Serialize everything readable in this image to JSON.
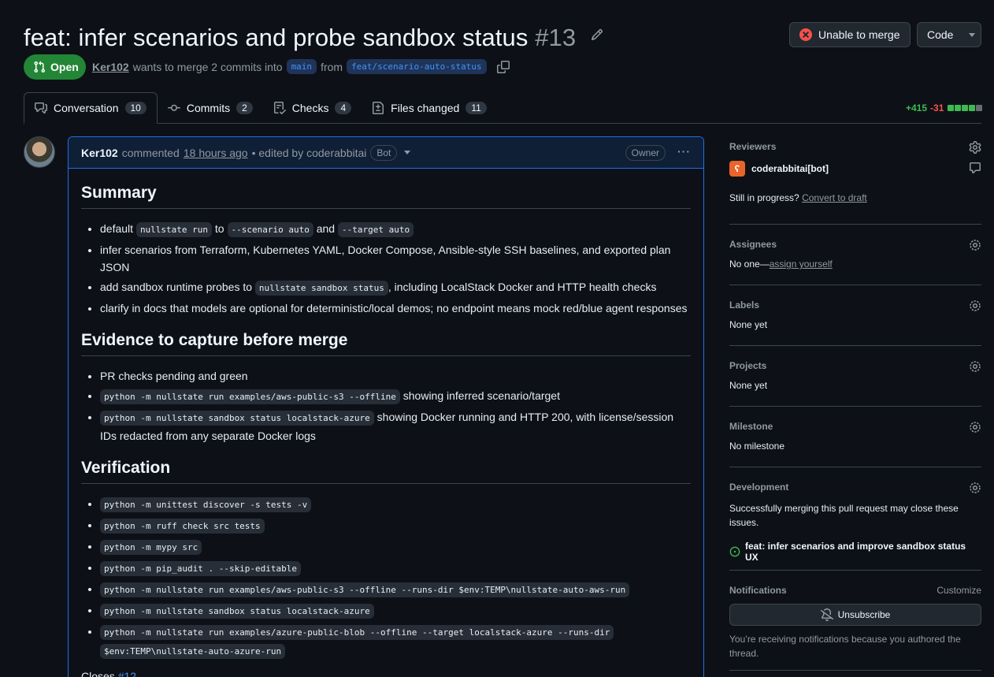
{
  "header": {
    "title": "feat: infer scenarios and probe sandbox status",
    "number": "#13",
    "unable_label": "Unable to merge",
    "code_label": "Code",
    "status": "Open",
    "author": "Ker102",
    "merge_text": "wants to merge 2 commits into",
    "base_branch": "main",
    "from_text": "from",
    "head_branch": "feat/scenario-auto-status"
  },
  "tabs": [
    {
      "label": "Conversation",
      "count": "10"
    },
    {
      "label": "Commits",
      "count": "2"
    },
    {
      "label": "Checks",
      "count": "4"
    },
    {
      "label": "Files changed",
      "count": "11"
    }
  ],
  "diffstat": {
    "added": "+415",
    "removed": "-31",
    "colors": [
      "#3fb950",
      "#3fb950",
      "#3fb950",
      "#3fb950",
      "#656c76"
    ]
  },
  "comment": {
    "author": "Ker102",
    "action": "commented",
    "time": "18 hours ago",
    "edited": "• edited by coderabbitai",
    "bot_label": "Bot",
    "owner_label": "Owner",
    "summary_heading": "Summary",
    "summary": {
      "i1": {
        "a": "default",
        "c1": "nullstate run",
        "b": "to",
        "c2": "--scenario auto",
        "d": "and",
        "c3": "--target auto"
      },
      "i2": "infer scenarios from Terraform, Kubernetes YAML, Docker Compose, Ansible-style SSH baselines, and exported plan JSON",
      "i3": {
        "a": "add sandbox runtime probes to",
        "c": "nullstate sandbox status",
        "b": ", including LocalStack Docker and HTTP health checks"
      },
      "i4": "clarify in docs that models are optional for deterministic/local demos; no endpoint means mock red/blue agent responses"
    },
    "evidence_heading": "Evidence to capture before merge",
    "evidence": {
      "i1": "PR checks pending and green",
      "i2": {
        "c": "python -m nullstate run examples/aws-public-s3 --offline",
        "t": "showing inferred scenario/target"
      },
      "i3": {
        "c": "python -m nullstate sandbox status localstack-azure",
        "t": "showing Docker running and HTTP 200, with license/session IDs redacted from any separate Docker logs"
      }
    },
    "verification_heading": "Verification",
    "verification": [
      "python -m unittest discover -s tests -v",
      "python -m ruff check src tests",
      "python -m mypy src",
      "python -m pip_audit . --skip-editable",
      "python -m nullstate run examples/aws-public-s3 --offline --runs-dir $env:TEMP\\nullstate-auto-aws-run",
      "python -m nullstate sandbox status localstack-azure"
    ],
    "verification_last_a": "python -m nullstate run examples/azure-public-blob --offline --target localstack-azure --runs-dir",
    "verification_last_b": "$env:TEMP\\nullstate-auto-azure-run",
    "closes_text": "Closes",
    "closes_link": "#12"
  },
  "sidebar": {
    "reviewers": {
      "heading": "Reviewers",
      "reviewer": "coderabbitai[bot]",
      "progress": "Still in progress?",
      "draft_link": "Convert to draft"
    },
    "assignees": {
      "heading": "Assignees",
      "text": "No one—",
      "link": "assign yourself"
    },
    "labels": {
      "heading": "Labels",
      "text": "None yet"
    },
    "projects": {
      "heading": "Projects",
      "text": "None yet"
    },
    "milestone": {
      "heading": "Milestone",
      "text": "No milestone"
    },
    "development": {
      "heading": "Development",
      "text": "Successfully merging this pull request may close these issues.",
      "issue": "feat: infer scenarios and improve sandbox status UX"
    },
    "notifications": {
      "heading": "Notifications",
      "customize": "Customize",
      "button": "Unsubscribe",
      "note": "You’re receiving notifications because you authored the thread."
    }
  }
}
